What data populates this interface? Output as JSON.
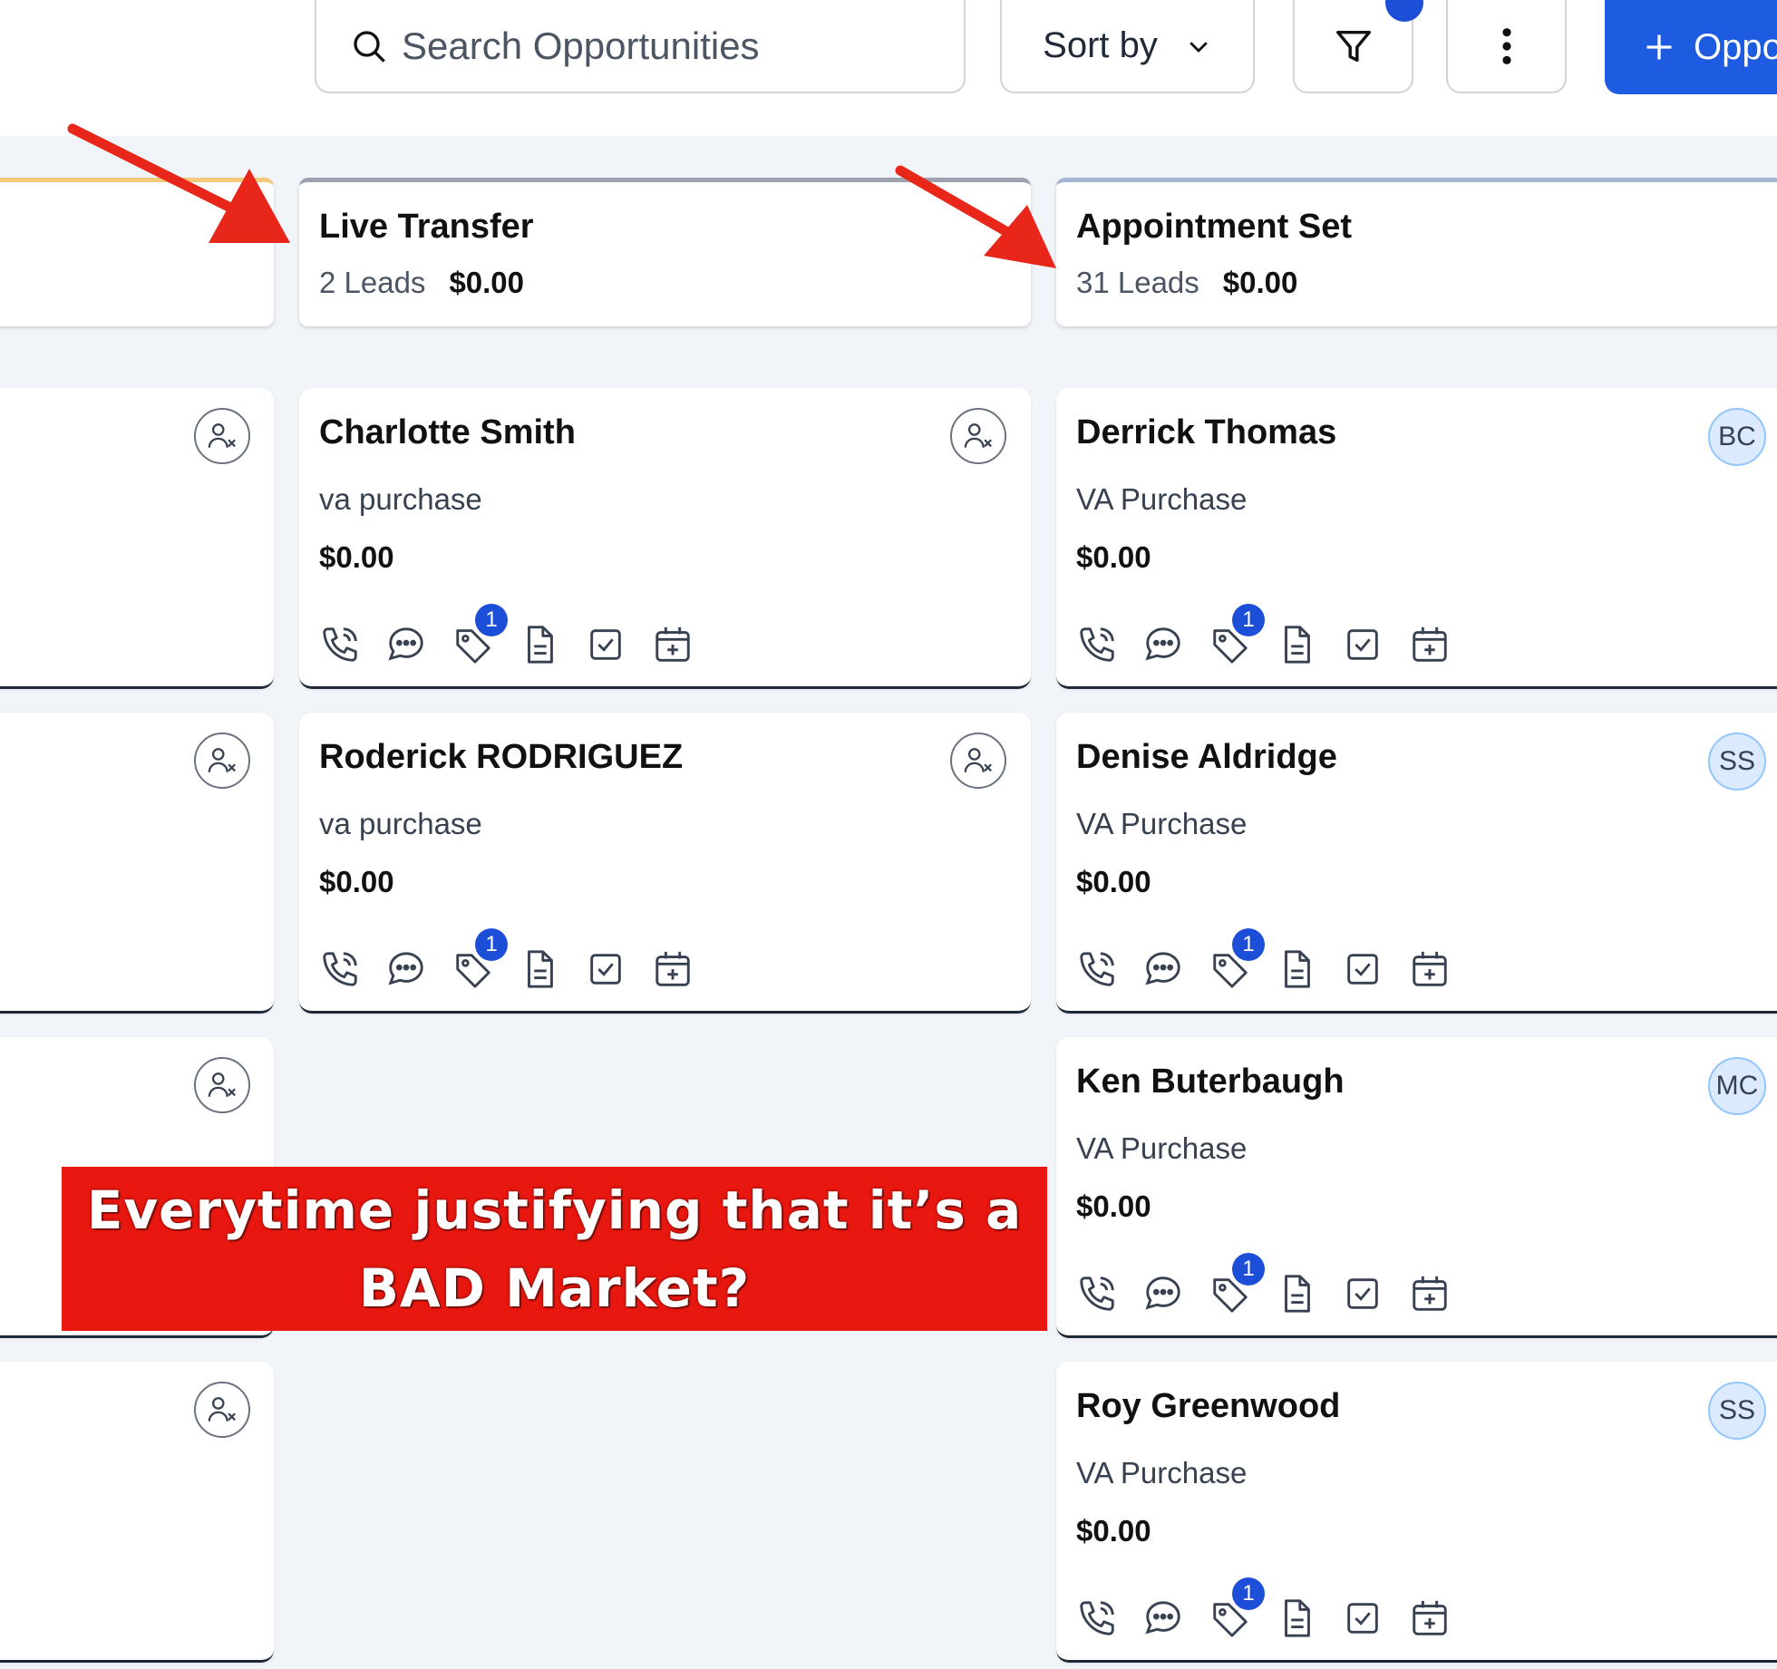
{
  "toolbar": {
    "search_placeholder": "Search Opportunities",
    "sort_label": "Sort by",
    "add_label": "Oppo"
  },
  "columns": [
    {
      "title": "Live Transfer",
      "leads": "2 Leads",
      "total": "$0.00",
      "cards": [
        {
          "name": "Charlotte Smith",
          "type": "va purchase",
          "amount": "$0.00",
          "tag_count": "1"
        },
        {
          "name": "Roderick RODRIGUEZ",
          "type": "va purchase",
          "amount": "$0.00",
          "tag_count": "1"
        }
      ]
    },
    {
      "title": "Appointment Set",
      "leads": "31 Leads",
      "total": "$0.00",
      "cards": [
        {
          "name": "Derrick Thomas",
          "type": "VA Purchase",
          "amount": "$0.00",
          "tag_count": "1",
          "avatar": "BC"
        },
        {
          "name": "Denise Aldridge",
          "type": "VA Purchase",
          "amount": "$0.00",
          "tag_count": "1",
          "avatar": "SS"
        },
        {
          "name": "Ken Buterbaugh",
          "type": "VA Purchase",
          "amount": "$0.00",
          "tag_count": "1",
          "avatar": "MC"
        },
        {
          "name": "Roy Greenwood",
          "type": "VA Purchase",
          "amount": "$0.00",
          "tag_count": "1",
          "avatar": "SS"
        }
      ]
    }
  ],
  "banner": {
    "line1": "Everytime justifying that it’s a",
    "line2": "BAD Market?"
  },
  "colors": {
    "accent": "#1d5be0",
    "badge": "#1d4ed8",
    "banner_red": "#e8170f",
    "arrow_red": "#e8261a"
  }
}
